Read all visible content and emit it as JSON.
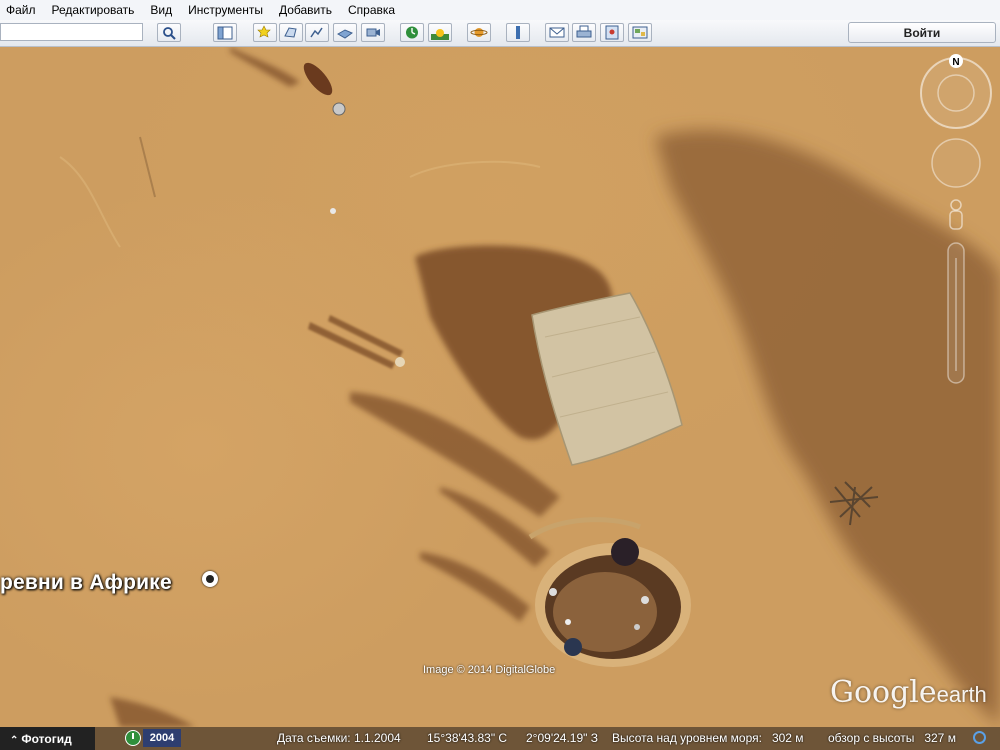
{
  "menu": [
    "Файл",
    "Редактировать",
    "Вид",
    "Инструменты",
    "Добавить",
    "Справка"
  ],
  "search": {
    "value": ""
  },
  "toolbar": {
    "buttons": [
      "sidebar-toggle-icon",
      "placemark-icon",
      "polygon-icon",
      "path-icon",
      "image-overlay-icon",
      "record-tour-icon",
      "historical-imagery-icon",
      "sunlight-icon",
      "planets-icon",
      "ruler-icon",
      "email-icon",
      "print-icon",
      "save-image-icon",
      "maps-icon"
    ],
    "login_label": "Войти"
  },
  "map": {
    "place_label": "ревни в Африке",
    "image_credit": "Image © 2014 DigitalGlobe",
    "logo_main": "Google",
    "logo_small": "earth",
    "compass_north": "N"
  },
  "status": {
    "tour_guide_label": "Фотогид",
    "imagery_year": "2004",
    "imagery_date": "Дата съемки: 1.1.2004",
    "latitude": "15°38'43.83\" С",
    "longitude": "2°09'24.19\" З",
    "elevation": "Высота над уровнем моря:   302 м",
    "eye_altitude": "обзор с высоты   327 м"
  },
  "colors": {
    "sand": "#cd9d60",
    "shadow": "#8a5a2e",
    "tent": "#d2c3a3"
  }
}
